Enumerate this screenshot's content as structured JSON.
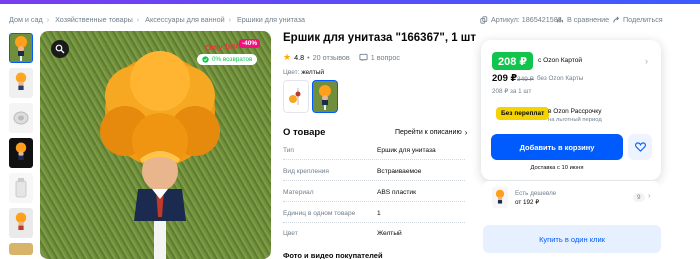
{
  "breadcrumb": [
    "Дом и сад",
    "Хозяйственные товары",
    "Аксессуары для ванной",
    "Ершики для унитаза"
  ],
  "meta": {
    "article": "Артикул: 1865421588",
    "compare": "В сравнение",
    "share": "Поделиться"
  },
  "gallery": {
    "badge_discount": "-40%",
    "badge_return": "0% возвратов",
    "brand_overlay": "Only brush"
  },
  "product": {
    "title": "Ершик для унитаза \"166367\", 1 шт",
    "rating": "4.8",
    "reviews": "20 отзывов",
    "questions": "1 вопрос",
    "color_label": "Цвет:",
    "color_value": "желтый",
    "about_title": "О товаре",
    "description_link": "Перейти к описанию",
    "specs": [
      {
        "name": "Тип",
        "value": "Ершик для унитаза"
      },
      {
        "name": "Вид крепления",
        "value": "Встраиваемое"
      },
      {
        "name": "Материал",
        "value": "ABS пластик"
      },
      {
        "name": "Единиц в одном товаре",
        "value": "1"
      },
      {
        "name": "Цвет",
        "value": "Желтый"
      }
    ],
    "photos_title": "Фото и видео покупателей"
  },
  "price_card": {
    "card_price": "208 ₽",
    "card_label": "с Ozon Картой",
    "price": "209 ₽",
    "old_price": "349 ₽",
    "no_card_label": "без Ozon Карты",
    "installment": "208 ₽ за 1 шт",
    "overpay_badge": "Без переплат",
    "installment_title": "в Ozon Рассрочку",
    "installment_sub": "на льготный период",
    "cart_button": "Добавить в корзину",
    "delivery": "Доставка с 10 июня"
  },
  "cheaper": {
    "label": "Есть дешевле",
    "price": "от 192 ₽",
    "count": "9"
  },
  "buy_one_click": "Купить в один клик",
  "colors": {
    "accent": "#005bff",
    "green": "#10c44c",
    "pink": "#f1117e",
    "yellow": "#f5d300"
  }
}
